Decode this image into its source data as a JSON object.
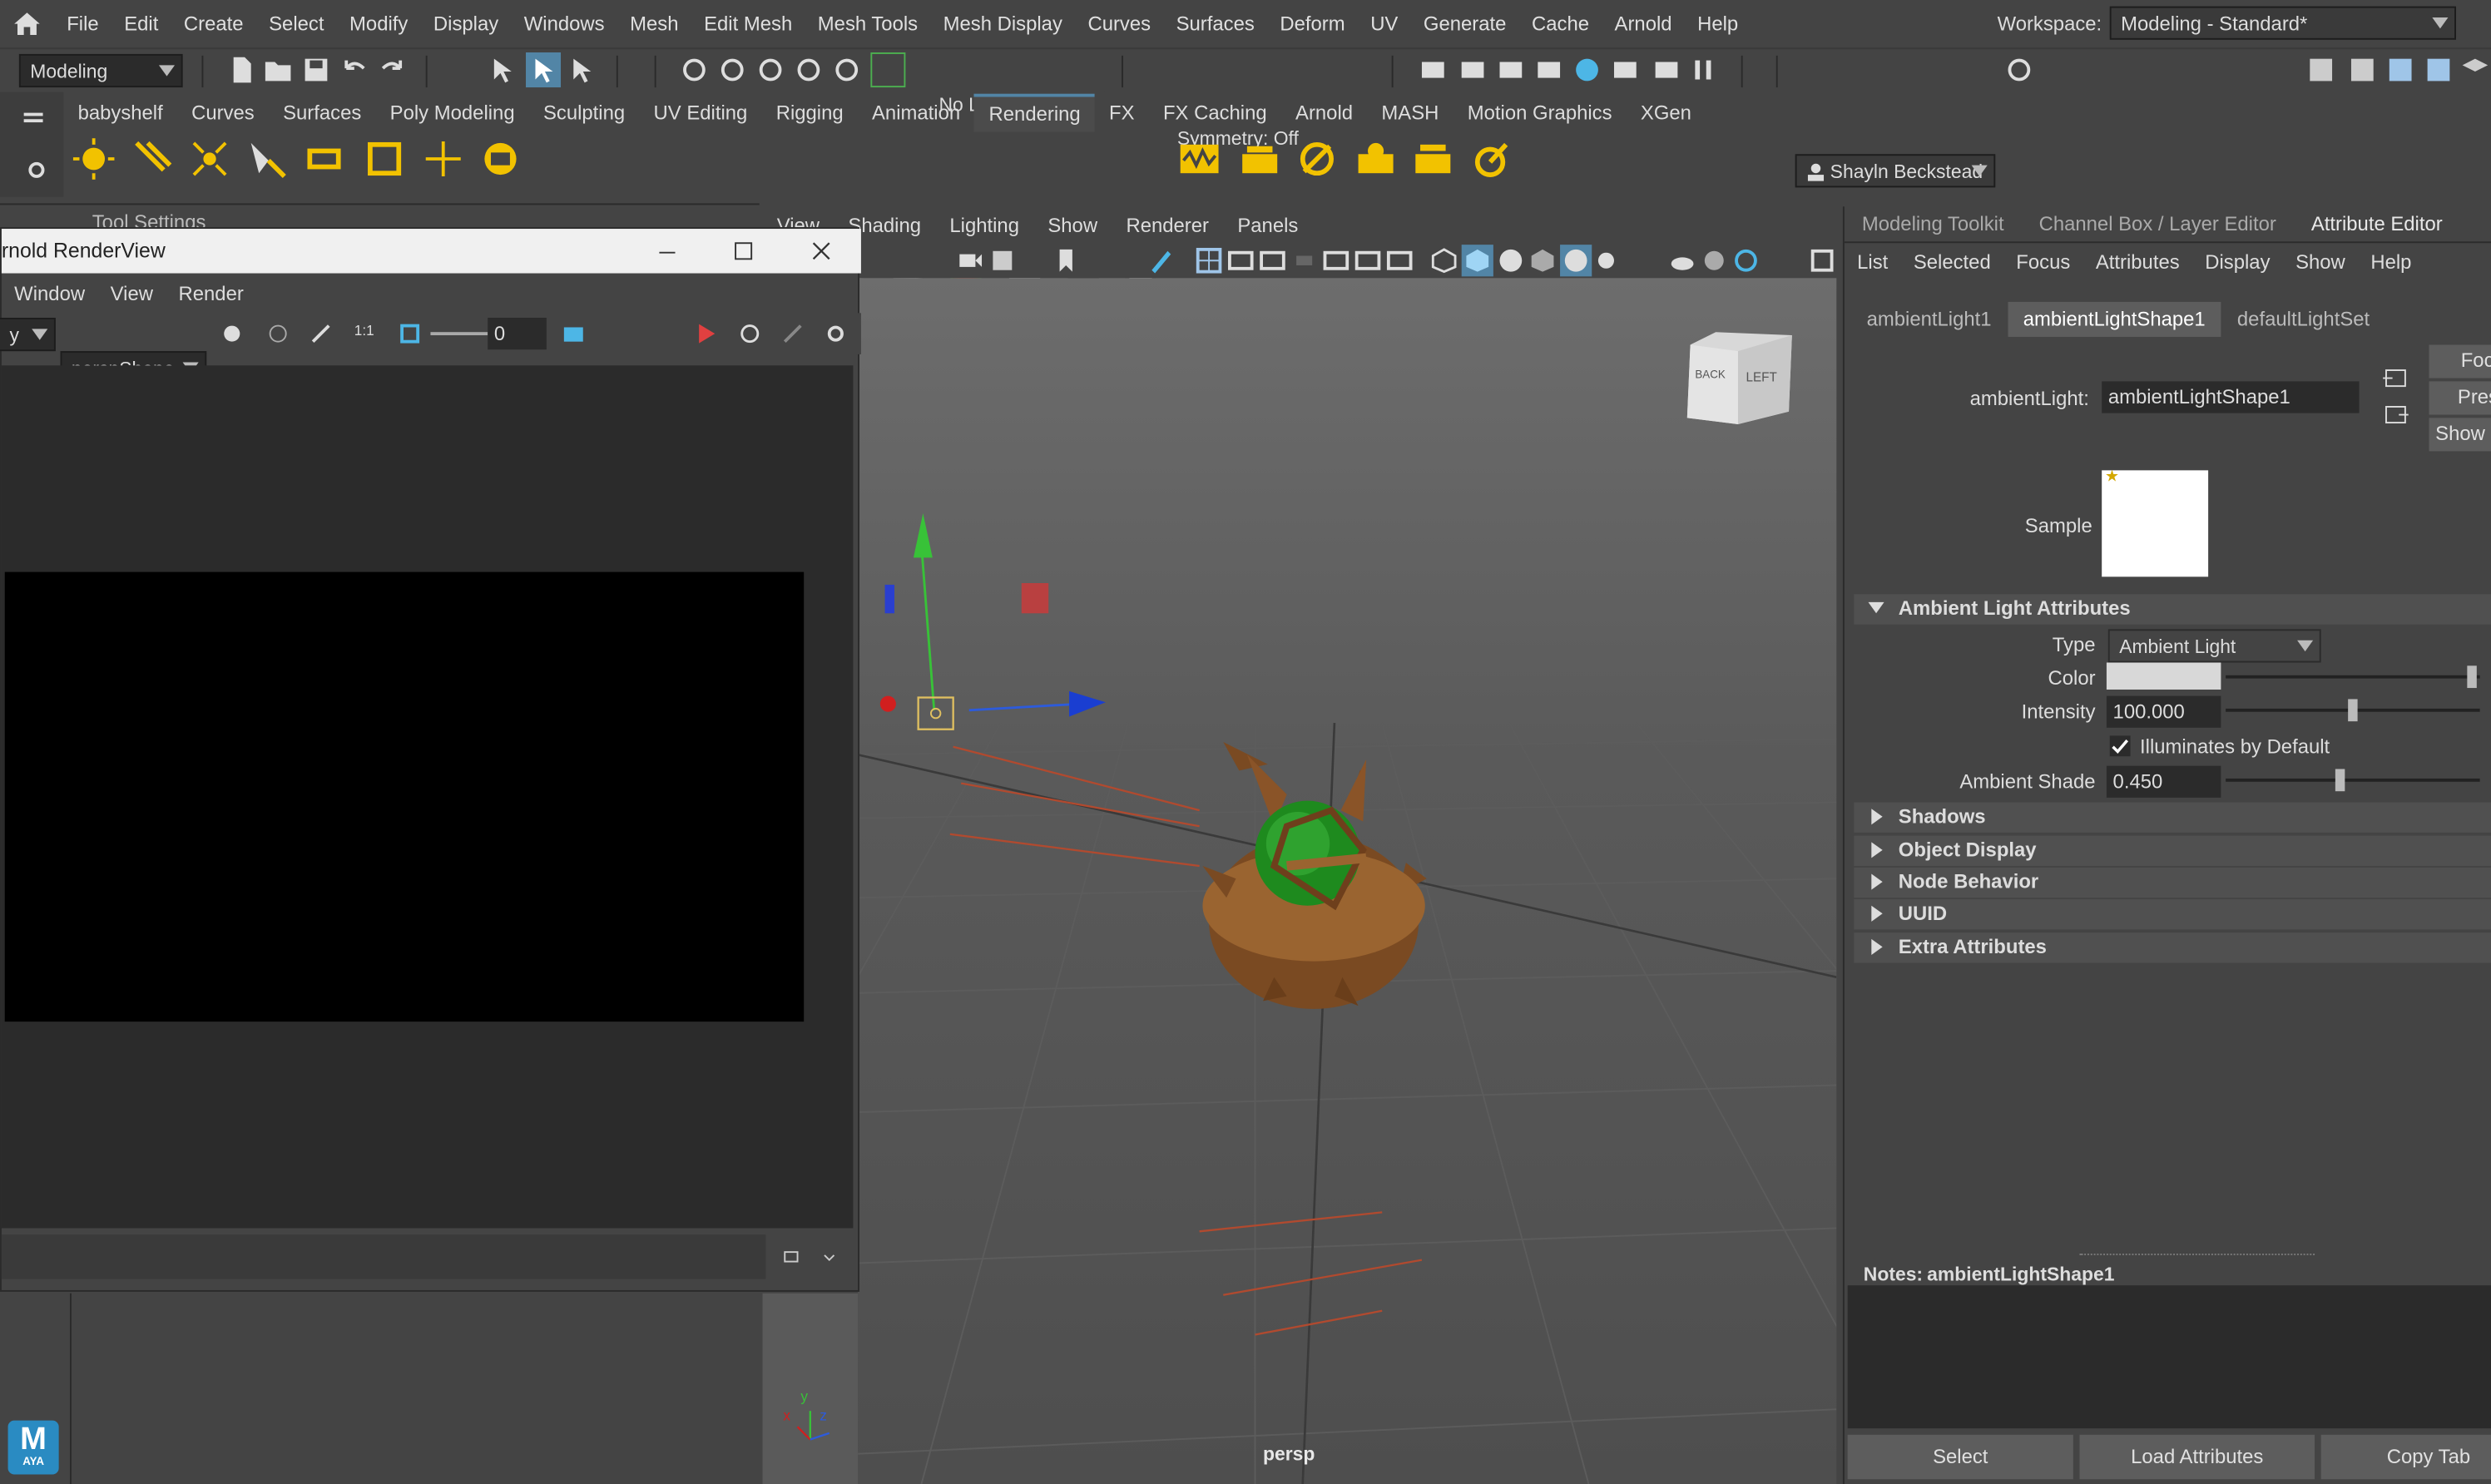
{
  "menu": [
    "File",
    "Edit",
    "Create",
    "Select",
    "Modify",
    "Display",
    "Windows",
    "Mesh",
    "Edit Mesh",
    "Mesh Tools",
    "Mesh Display",
    "Curves",
    "Surfaces",
    "Deform",
    "UV",
    "Generate",
    "Cache",
    "Arnold",
    "Help"
  ],
  "workspace": {
    "label": "Workspace:",
    "value": "Modeling - Standard*"
  },
  "status": {
    "mode": "Modeling",
    "live_surface": "No Live Surface",
    "symmetry": "Symmetry: Off",
    "user": "Shayln Beckstead"
  },
  "shelf_tabs": [
    "babyshelf",
    "Curves",
    "Surfaces",
    "Poly Modeling",
    "Sculpting",
    "UV Editing",
    "Rigging",
    "Animation",
    "Rendering",
    "FX",
    "FX Caching",
    "Arnold",
    "MASH",
    "Motion Graphics",
    "XGen"
  ],
  "shelf_active": "Rendering",
  "tool_settings": "Tool Settings",
  "panel_menu": [
    "View",
    "Shading",
    "Lighting",
    "Show",
    "Renderer",
    "Panels"
  ],
  "viewport": {
    "camera_label": "persp",
    "cube_back": "BACK",
    "cube_left": "LEFT",
    "axis_y": "y",
    "axis_x": "x",
    "axis_z": "z"
  },
  "renderview": {
    "title": "rnold RenderView",
    "menu": [
      "Window",
      "View",
      "Render"
    ],
    "camera": "perspShape",
    "camera_prefix": "y",
    "frame": "0",
    "ratio": "1:1"
  },
  "attr_editor": {
    "top_tabs": [
      "Modeling Toolkit",
      "Channel Box / Layer Editor",
      "Attribute Editor"
    ],
    "active_top_tab": "Attribute Editor",
    "menu": [
      "List",
      "Selected",
      "Focus",
      "Attributes",
      "Display",
      "Show",
      "Help"
    ],
    "node_tabs": [
      "ambientLight1",
      "ambientLightShape1",
      "defaultLightSet"
    ],
    "active_node_tab": "ambientLightShape1",
    "node_label": "ambientLight:",
    "node_value": "ambientLightShape1",
    "side_buttons": [
      "Foc",
      "Pres",
      "Show"
    ],
    "sample_label": "Sample",
    "section_main": "Ambient Light Attributes",
    "type_label": "Type",
    "type_value": "Ambient Light",
    "color_label": "Color",
    "color_value": "#d8d8d8",
    "intensity_label": "Intensity",
    "intensity_value": "100.000",
    "illuminates_label": "Illuminates by Default",
    "illuminates_checked": true,
    "ambient_shade_label": "Ambient Shade",
    "ambient_shade_value": "0.450",
    "collapsed_sections": [
      "Shadows",
      "Object Display",
      "Node Behavior",
      "UUID",
      "Extra Attributes"
    ],
    "notes_label": "Notes:",
    "notes_value": "ambientLightShape1",
    "bottom_buttons": [
      "Select",
      "Load Attributes",
      "Copy Tab"
    ]
  },
  "logo": {
    "letter": "M",
    "text": "AYA"
  }
}
